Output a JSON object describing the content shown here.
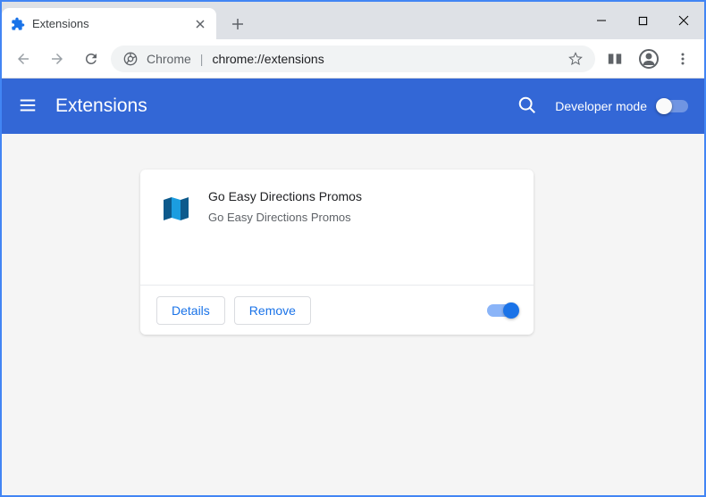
{
  "tab": {
    "title": "Extensions"
  },
  "omnibox": {
    "chrome_label": "Chrome",
    "url": "chrome://extensions"
  },
  "header": {
    "title": "Extensions",
    "dev_mode_label": "Developer mode",
    "dev_mode_enabled": false
  },
  "extension": {
    "name": "Go Easy Directions Promos",
    "description": "Go Easy Directions Promos",
    "details_label": "Details",
    "remove_label": "Remove",
    "enabled": true
  }
}
